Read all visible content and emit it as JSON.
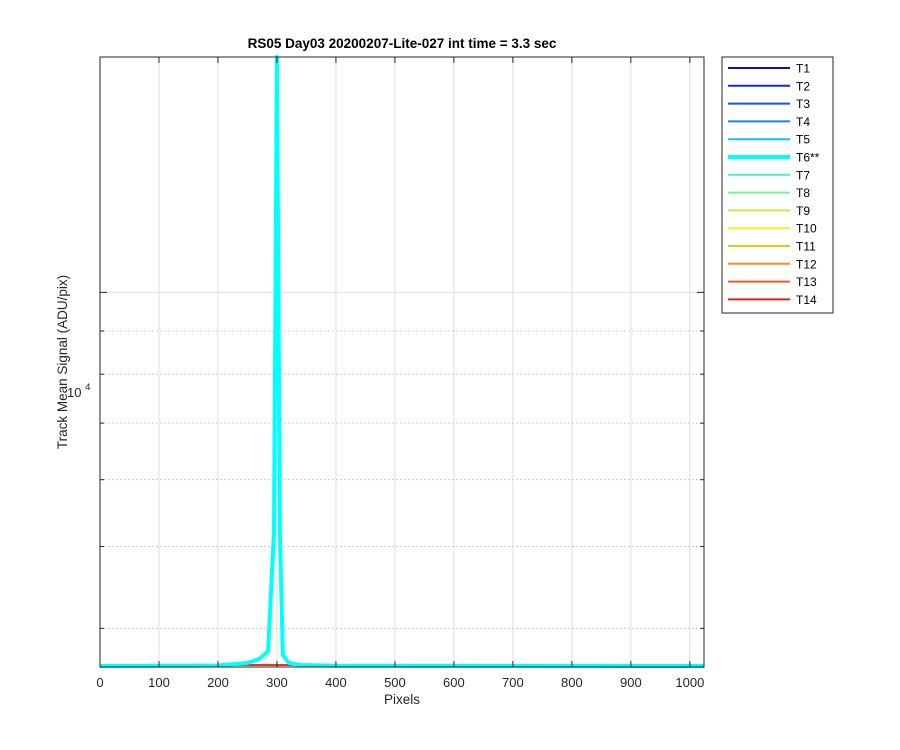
{
  "chart_data": {
    "type": "line",
    "title": "RS05 Day03 20200207-Lite-027 int time = 3.3 sec",
    "xlabel": "Pixels",
    "ylabel": "Track Mean Signal (ADU/pix)",
    "xlim": [
      0,
      1024
    ],
    "ylim": [
      3600,
      19000
    ],
    "yscale": "log",
    "xticks": [
      0,
      100,
      200,
      300,
      400,
      500,
      600,
      700,
      800,
      900,
      1000
    ],
    "xtick_labels": [
      "0",
      "100",
      "200",
      "300",
      "400",
      "500",
      "600",
      "700",
      "800",
      "900",
      "1000"
    ],
    "ytick_base": "10",
    "ytick_exponent": "4",
    "major_ytick_value": 10000,
    "minor_yticks": [
      4000,
      5000,
      6000,
      7000,
      8000,
      9000,
      20000
    ],
    "grid": true,
    "legend_position": "outside-right",
    "series": [
      {
        "name": "T1",
        "color": "#0a10b8",
        "width": 1.5,
        "x": [
          0,
          1024
        ],
        "y": [
          3620,
          3620
        ]
      },
      {
        "name": "T2",
        "color": "#0b2ae0",
        "width": 1.5,
        "x": [
          0,
          1024
        ],
        "y": [
          3620,
          3620
        ]
      },
      {
        "name": "T3",
        "color": "#1a52ea",
        "width": 1.5,
        "x": [
          0,
          1024
        ],
        "y": [
          3620,
          3620
        ]
      },
      {
        "name": "T4",
        "color": "#1f82e8",
        "width": 1.5,
        "x": [
          0,
          1024
        ],
        "y": [
          3620,
          3620
        ]
      },
      {
        "name": "T5",
        "color": "#1cbcf2",
        "width": 1.5,
        "x": [
          0,
          1024
        ],
        "y": [
          3620,
          3620
        ]
      },
      {
        "name": "T6**",
        "color": "#00ffff",
        "width": 4,
        "x": [
          0,
          200,
          250,
          270,
          285,
          295,
          300,
          305,
          310,
          320,
          340,
          400,
          1024
        ],
        "y": [
          3610,
          3615,
          3640,
          3680,
          3760,
          5200,
          19000,
          5200,
          3720,
          3640,
          3620,
          3612,
          3610
        ]
      },
      {
        "name": "T7",
        "color": "#43f0cb",
        "width": 1.5,
        "x": [
          0,
          1024
        ],
        "y": [
          3620,
          3620
        ]
      },
      {
        "name": "T8",
        "color": "#7cf28a",
        "width": 1.5,
        "x": [
          0,
          1024
        ],
        "y": [
          3620,
          3620
        ]
      },
      {
        "name": "T9",
        "color": "#bdf440",
        "width": 1.5,
        "x": [
          0,
          1024
        ],
        "y": [
          3620,
          3620
        ]
      },
      {
        "name": "T10",
        "color": "#f6f02c",
        "width": 1.5,
        "x": [
          0,
          1024
        ],
        "y": [
          3620,
          3620
        ]
      },
      {
        "name": "T11",
        "color": "#f2c21b",
        "width": 1.5,
        "x": [
          0,
          1024
        ],
        "y": [
          3620,
          3620
        ]
      },
      {
        "name": "T12",
        "color": "#f59020",
        "width": 1.5,
        "x": [
          0,
          1024
        ],
        "y": [
          3620,
          3620
        ]
      },
      {
        "name": "T13",
        "color": "#f55a22",
        "width": 1.5,
        "x": [
          0,
          1024
        ],
        "y": [
          3620,
          3620
        ]
      },
      {
        "name": "T14",
        "color": "#e11f14",
        "width": 1.5,
        "x": [
          0,
          1024
        ],
        "y": [
          3620,
          3620
        ]
      }
    ]
  }
}
